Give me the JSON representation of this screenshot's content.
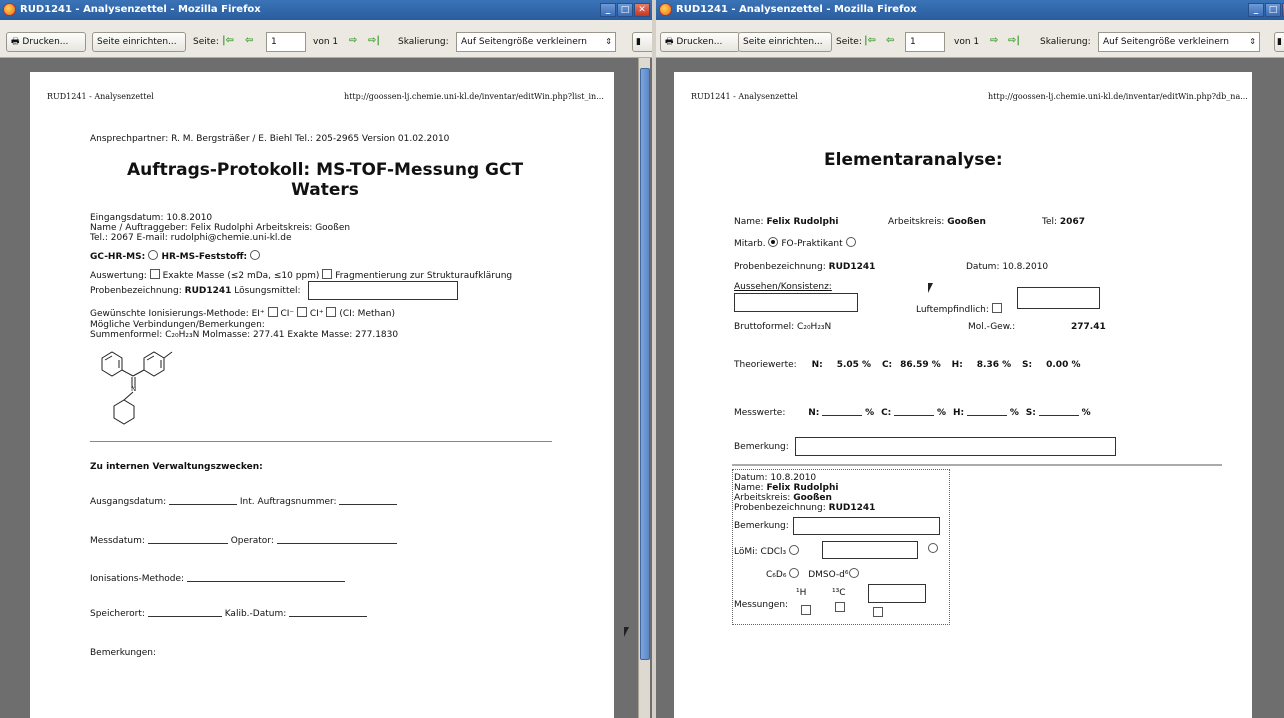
{
  "window_title": "RUD1241 - Analysenzettel - Mozilla Firefox",
  "toolbar": {
    "print_label": "Drucken...",
    "page_setup_label": "Seite einrichten...",
    "page_label": "Seite:",
    "page_value": "1",
    "of_label": "von 1",
    "scale_label": "Skalierung:",
    "scale_value": "Auf Seitengröße verkleinern"
  },
  "left_page": {
    "header_left": "RUD1241 - Analysenzettel",
    "header_right": "http://goossen-lj.chemie.uni-kl.de/inventar/editWin.php?list_in...",
    "contact": "Ansprechpartner: R. M. Bergsträßer / E. Biehl Tel.: 205-2965   Version 01.02.2010",
    "title_line1": "Auftrags-Protokoll: MS-TOF-Messung GCT",
    "title_line2": "Waters",
    "eingang": "Eingangsdatum: 10.8.2010",
    "auftraggeber": "Name / Auftraggeber: Felix Rudolphi Arbeitskreis: Gooßen",
    "tel_email": "Tel.: 2067 E-mail: rudolphi@chemie.uni-kl.de",
    "gc_hr_ms": "GC-HR-MS:",
    "hr_ms_feststoff": "HR-MS-Feststoff:",
    "auswertung": "Auswertung:",
    "exakte_masse": "Exakte Masse (≤2 mDa, ≤10 ppm)",
    "fragmentierung": "Fragmentierung zur Strukturaufklärung",
    "probenbez_label": "Probenbezeichnung:",
    "probenbez_value": "RUD1241",
    "loesungsmittel": "Lösungsmittel:",
    "ionisierung": "Gewünschte Ionisierungs-Methode: EI⁺",
    "ci_minus": "CI⁻",
    "ci_plus": "CI⁺",
    "ci_methan": "(CI: Methan)",
    "moegliche": "Mögliche Verbindungen/Bemerkungen:",
    "summenformel": "Summenformel: C₂₀H₂₃N Molmasse: 277.41 Exakte Masse: 277.1830",
    "intern_heading": "Zu internen Verwaltungszwecken:",
    "ausgangsdatum": "Ausgangsdatum:",
    "int_auftragsnummer": "Int. Auftragsnummer:",
    "messdatum": "Messdatum:",
    "operator": "Operator:",
    "ionisations_methode": "Ionisations-Methode:",
    "speicherort": "Speicherort:",
    "kalib_datum": "Kalib.-Datum:",
    "bemerkungen": "Bemerkungen:"
  },
  "right_page": {
    "header_left": "RUD1241 - Analysenzettel",
    "header_right": "http://goossen-lj.chemie.uni-kl.de/inventar/editWin.php?db_na...",
    "title": "Elementaranalyse:",
    "name_label": "Name:",
    "name_value": "Felix Rudolphi",
    "ak_label": "Arbeitskreis:",
    "ak_value": "Gooßen",
    "tel_label": "Tel:",
    "tel_value": "2067",
    "mitarb": "Mitarb.",
    "fo_praktikant": "FO-Praktikant",
    "probenbez_label": "Probenbezeichnung:",
    "probenbez_value": "RUD1241",
    "datum": "Datum: 10.8.2010",
    "aussehen": "Aussehen/Konsistenz:",
    "luftempfindlich": "Luftempfindlich:",
    "bruttoformel": "Bruttoformel: C₂₀H₂₃N",
    "molgew_label": "Mol.-Gew.:",
    "molgew_value": "277.41",
    "theorie_label": "Theoriewerte:",
    "theorie_n": "N:",
    "theorie_n_val": "5.05 %",
    "theorie_c": "C:",
    "theorie_c_val": "86.59 %",
    "theorie_h": "H:",
    "theorie_h_val": "8.36 %",
    "theorie_s": "S:",
    "theorie_s_val": "0.00 %",
    "mess_label": "Messwerte:",
    "mess_n": "N:",
    "mess_c": "C:",
    "mess_h": "H:",
    "mess_s": "S:",
    "percent": "%",
    "bemerkung": "Bemerkung:",
    "box_datum": "Datum: 10.8.2010",
    "box_name_label": "Name:",
    "box_name_value": "Felix Rudolphi",
    "box_ak_label": "Arbeitskreis:",
    "box_ak_value": "Gooßen",
    "box_proben_label": "Probenbezeichnung:",
    "box_proben_value": "RUD1241",
    "box_bemerkung": "Bemerkung:",
    "loemi": "LöMi:",
    "cdcl3": "CDCl₃",
    "c6d6": "C₆D₆",
    "dmso": "DMSO-d⁶",
    "messungen": "Messungen:",
    "h1": "¹H",
    "c13": "¹³C"
  }
}
